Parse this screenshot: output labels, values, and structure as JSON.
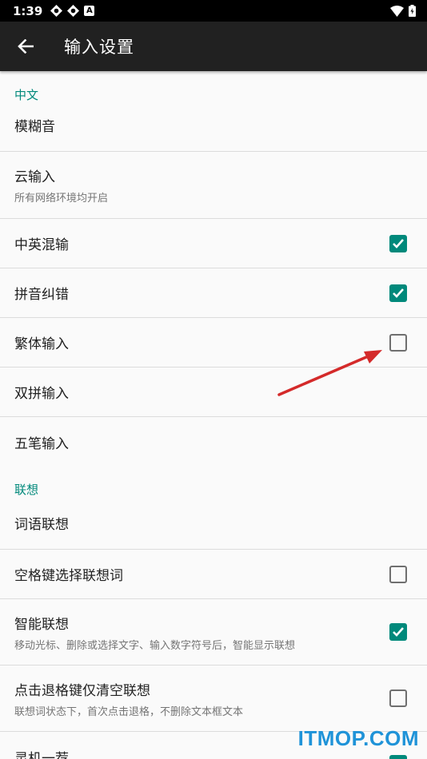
{
  "status_bar": {
    "time": "1:39",
    "a_badge": "A"
  },
  "toolbar": {
    "title": "输入设置"
  },
  "sections": {
    "chinese": {
      "header": "中文"
    },
    "association": {
      "header": "联想"
    }
  },
  "rows": {
    "fuzzy": {
      "title": "模糊音"
    },
    "cloud": {
      "title": "云输入",
      "subtitle": "所有网络环境均开启"
    },
    "mixed": {
      "title": "中英混输",
      "checked": true
    },
    "pinyin_correct": {
      "title": "拼音纠错",
      "checked": true
    },
    "traditional": {
      "title": "繁体输入",
      "checked": false
    },
    "shuangpin": {
      "title": "双拼输入"
    },
    "wubi": {
      "title": "五笔输入"
    },
    "word_assoc": {
      "title": "词语联想"
    },
    "space_select": {
      "title": "空格键选择联想词",
      "checked": false
    },
    "smart_assoc": {
      "title": "智能联想",
      "subtitle": "移动光标、删除或选择文字、输入数字符号后，智能显示联想",
      "checked": true
    },
    "backspace_clear": {
      "title": "点击退格键仅清空联想",
      "subtitle": "联想词状态下，首次点击退格，不删除文本框文本",
      "checked": false
    },
    "lingji": {
      "title": "灵机一荐",
      "checked": true
    }
  },
  "watermark": "ITMOP.COM",
  "colors": {
    "accent": "#00897b",
    "toolbar": "#212121",
    "annotation_arrow": "#d42a2a",
    "watermark": "#1f93d8"
  }
}
